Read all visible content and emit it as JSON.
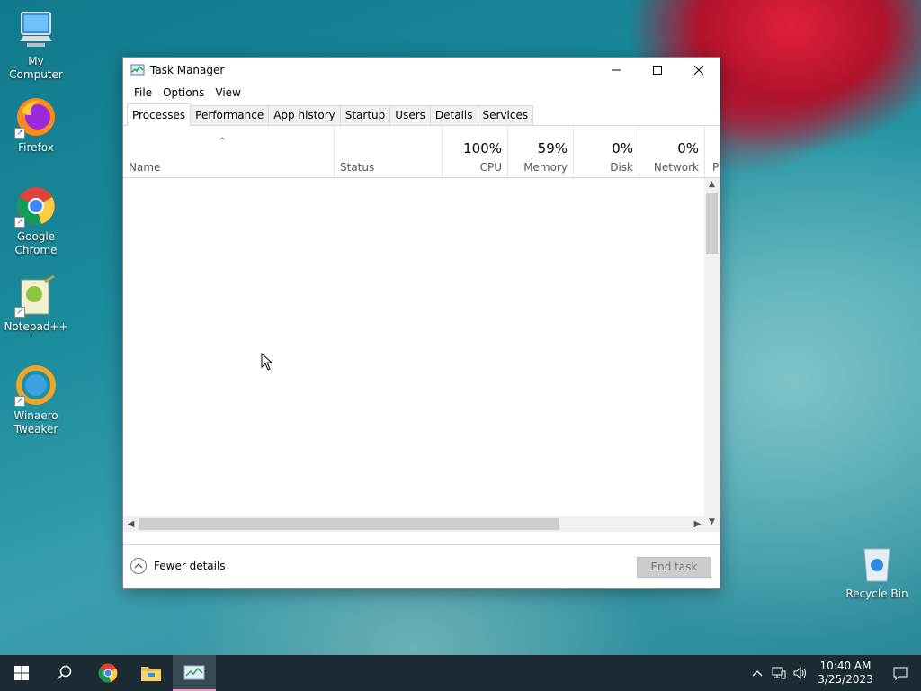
{
  "desktop": {
    "icons": [
      {
        "label": "My Computer"
      },
      {
        "label": "Firefox"
      },
      {
        "label": "Google Chrome"
      },
      {
        "label": "Notepad++"
      },
      {
        "label": "Winaero Tweaker"
      },
      {
        "label": "Recycle Bin"
      }
    ]
  },
  "window": {
    "title": "Task Manager",
    "menu": [
      "File",
      "Options",
      "View"
    ],
    "tabs": [
      "Processes",
      "Performance",
      "App history",
      "Startup",
      "Users",
      "Details",
      "Services"
    ],
    "active_tab": "Processes",
    "columns": {
      "name": "Name",
      "status": "Status",
      "cpu": {
        "value": "100%",
        "label": "CPU"
      },
      "memory": {
        "value": "59%",
        "label": "Memory"
      },
      "disk": {
        "value": "0%",
        "label": "Disk"
      },
      "network": {
        "value": "0%",
        "label": "Network"
      },
      "power": {
        "label": "P"
      }
    },
    "footer": {
      "fewer_details": "Fewer details",
      "end_task": "End task"
    }
  },
  "taskbar": {
    "clock": {
      "time": "10:40 AM",
      "date": "3/25/2023"
    }
  }
}
